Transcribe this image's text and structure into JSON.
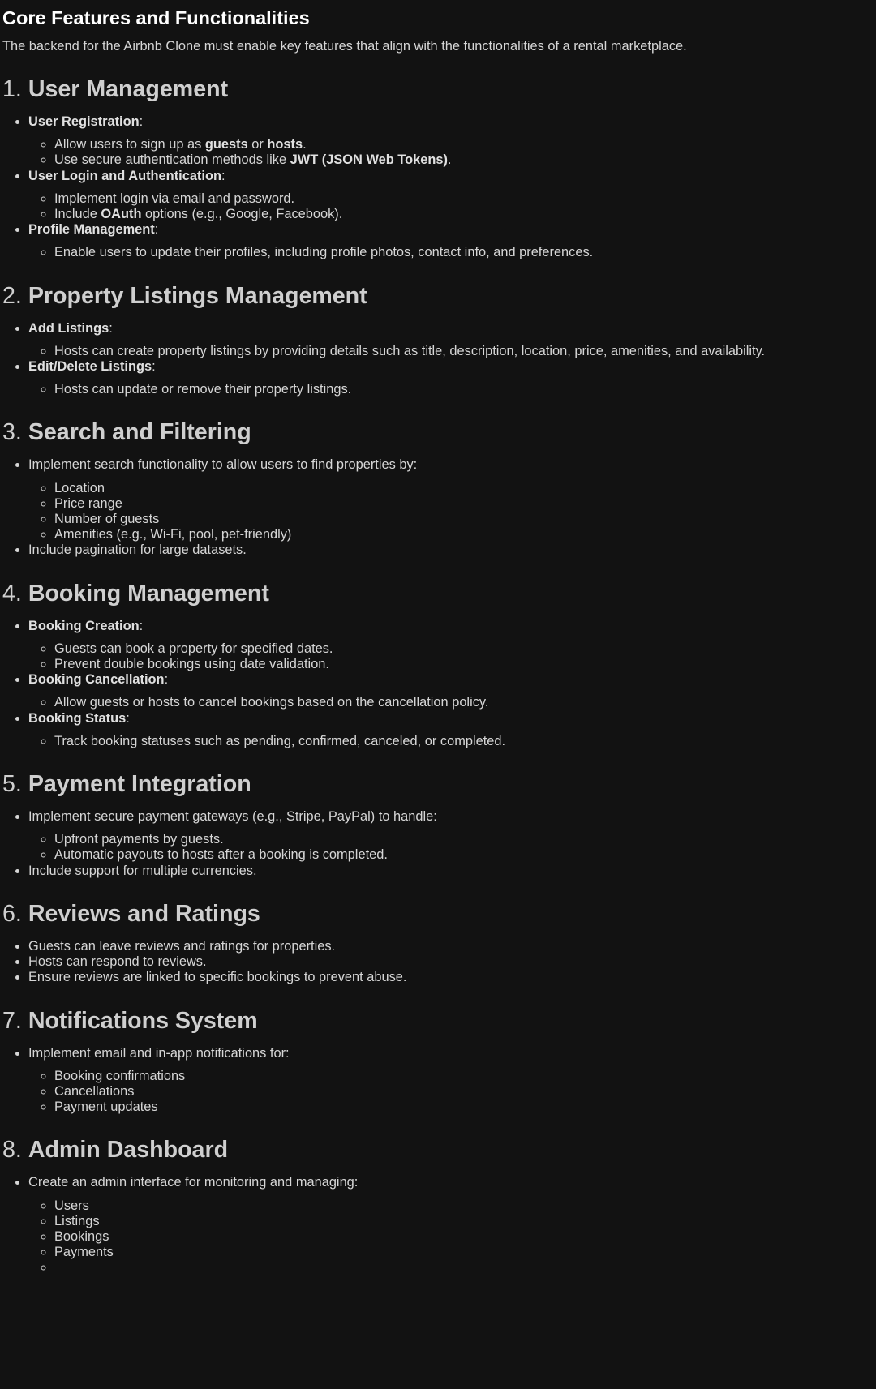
{
  "page_title": "Core Features and Functionalities",
  "intro": "The backend for the Airbnb Clone must enable key features that align with the functionalities of a rental marketplace.",
  "sections": [
    {
      "number": "1.",
      "title": "User Management",
      "items": [
        {
          "label": "User Registration",
          "suffix": ":",
          "subitems": [
            [
              {
                "t": "Allow users to sign up as "
              },
              {
                "b": "guests"
              },
              {
                "t": " or "
              },
              {
                "b": "hosts"
              },
              {
                "t": "."
              }
            ],
            [
              {
                "t": "Use secure authentication methods like "
              },
              {
                "b": "JWT (JSON Web Tokens)"
              },
              {
                "t": "."
              }
            ]
          ]
        },
        {
          "label": "User Login and Authentication",
          "suffix": ":",
          "subitems": [
            [
              {
                "t": "Implement login via email and password."
              }
            ],
            [
              {
                "t": "Include "
              },
              {
                "b": "OAuth"
              },
              {
                "t": " options (e.g., Google, Facebook)."
              }
            ]
          ]
        },
        {
          "label": "Profile Management",
          "suffix": ":",
          "subitems": [
            [
              {
                "t": "Enable users to update their profiles, including profile photos, contact info, and preferences."
              }
            ]
          ]
        }
      ]
    },
    {
      "number": "2.",
      "title": "Property Listings Management",
      "items": [
        {
          "label": "Add Listings",
          "suffix": ":",
          "subitems": [
            [
              {
                "t": "Hosts can create property listings by providing details such as title, description, location, price, amenities, and availability."
              }
            ]
          ]
        },
        {
          "label": "Edit/Delete Listings",
          "suffix": ":",
          "subitems": [
            [
              {
                "t": "Hosts can update or remove their property listings."
              }
            ]
          ]
        }
      ]
    },
    {
      "number": "3.",
      "title": "Search and Filtering",
      "items": [
        {
          "text": "Implement search functionality to allow users to find properties by:",
          "subitems": [
            [
              {
                "t": "Location"
              }
            ],
            [
              {
                "t": "Price range"
              }
            ],
            [
              {
                "t": "Number of guests"
              }
            ],
            [
              {
                "t": "Amenities (e.g., Wi-Fi, pool, pet-friendly)"
              }
            ]
          ]
        },
        {
          "text": "Include pagination for large datasets."
        }
      ]
    },
    {
      "number": "4.",
      "title": "Booking Management",
      "items": [
        {
          "label": "Booking Creation",
          "suffix": ":",
          "subitems": [
            [
              {
                "t": "Guests can book a property for specified dates."
              }
            ],
            [
              {
                "t": "Prevent double bookings using date validation."
              }
            ]
          ]
        },
        {
          "label": "Booking Cancellation",
          "suffix": ":",
          "subitems": [
            [
              {
                "t": "Allow guests or hosts to cancel bookings based on the cancellation policy."
              }
            ]
          ]
        },
        {
          "label": "Booking Status",
          "suffix": ":",
          "subitems": [
            [
              {
                "t": "Track booking statuses such as pending, confirmed, canceled, or completed."
              }
            ]
          ]
        }
      ]
    },
    {
      "number": "5.",
      "title": "Payment Integration",
      "items": [
        {
          "text": "Implement secure payment gateways (e.g., Stripe, PayPal) to handle:",
          "subitems": [
            [
              {
                "t": "Upfront payments by guests."
              }
            ],
            [
              {
                "t": "Automatic payouts to hosts after a booking is completed."
              }
            ]
          ]
        },
        {
          "text": "Include support for multiple currencies."
        }
      ]
    },
    {
      "number": "6.",
      "title": "Reviews and Ratings",
      "items": [
        {
          "text": "Guests can leave reviews and ratings for properties."
        },
        {
          "text": "Hosts can respond to reviews."
        },
        {
          "text": "Ensure reviews are linked to specific bookings to prevent abuse."
        }
      ]
    },
    {
      "number": "7.",
      "title": "Notifications System",
      "items": [
        {
          "text": "Implement email and in-app notifications for:",
          "subitems": [
            [
              {
                "t": "Booking confirmations"
              }
            ],
            [
              {
                "t": "Cancellations"
              }
            ],
            [
              {
                "t": "Payment updates"
              }
            ]
          ]
        }
      ]
    },
    {
      "number": "8.",
      "title": "Admin Dashboard",
      "items": [
        {
          "text": "Create an admin interface for monitoring and managing:",
          "subitems": [
            [
              {
                "t": "Users"
              }
            ],
            [
              {
                "t": "Listings"
              }
            ],
            [
              {
                "t": "Bookings"
              }
            ],
            [
              {
                "t": "Payments"
              }
            ],
            [
              {
                "t": ""
              }
            ]
          ]
        }
      ]
    }
  ]
}
